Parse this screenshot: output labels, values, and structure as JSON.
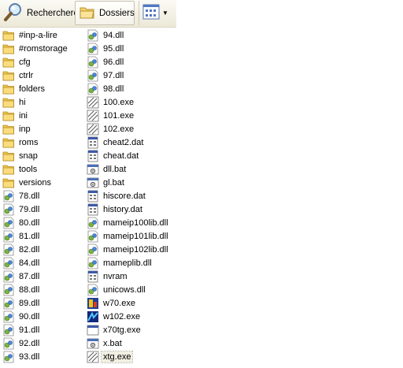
{
  "toolbar": {
    "search_label": "Recherchercher",
    "folders_label": "Dossiers"
  },
  "files_col1": [
    {
      "name": "#inp-a-lire",
      "type": "folder"
    },
    {
      "name": "#romstorage",
      "type": "folder"
    },
    {
      "name": "cfg",
      "type": "folder"
    },
    {
      "name": "ctrlr",
      "type": "folder"
    },
    {
      "name": "folders",
      "type": "folder"
    },
    {
      "name": "hi",
      "type": "folder"
    },
    {
      "name": "ini",
      "type": "folder"
    },
    {
      "name": "inp",
      "type": "folder"
    },
    {
      "name": "roms",
      "type": "folder"
    },
    {
      "name": "snap",
      "type": "folder"
    },
    {
      "name": "tools",
      "type": "folder"
    },
    {
      "name": "versions",
      "type": "folder"
    },
    {
      "name": "78.dll",
      "type": "dll"
    },
    {
      "name": "79.dll",
      "type": "dll"
    },
    {
      "name": "80.dll",
      "type": "dll"
    },
    {
      "name": "81.dll",
      "type": "dll"
    },
    {
      "name": "82.dll",
      "type": "dll"
    },
    {
      "name": "84.dll",
      "type": "dll"
    },
    {
      "name": "87.dll",
      "type": "dll"
    },
    {
      "name": "88.dll",
      "type": "dll"
    },
    {
      "name": "89.dll",
      "type": "dll"
    },
    {
      "name": "90.dll",
      "type": "dll"
    },
    {
      "name": "91.dll",
      "type": "dll"
    },
    {
      "name": "92.dll",
      "type": "dll"
    },
    {
      "name": "93.dll",
      "type": "dll"
    }
  ],
  "files_col2": [
    {
      "name": "94.dll",
      "type": "dll"
    },
    {
      "name": "95.dll",
      "type": "dll"
    },
    {
      "name": "96.dll",
      "type": "dll"
    },
    {
      "name": "97.dll",
      "type": "dll"
    },
    {
      "name": "98.dll",
      "type": "dll"
    },
    {
      "name": "100.exe",
      "type": "exe"
    },
    {
      "name": "101.exe",
      "type": "exe"
    },
    {
      "name": "102.exe",
      "type": "exe"
    },
    {
      "name": "cheat2.dat",
      "type": "dat"
    },
    {
      "name": "cheat.dat",
      "type": "dat"
    },
    {
      "name": "dll.bat",
      "type": "bat"
    },
    {
      "name": "gl.bat",
      "type": "bat"
    },
    {
      "name": "hiscore.dat",
      "type": "dat"
    },
    {
      "name": "history.dat",
      "type": "dat"
    },
    {
      "name": "mameip100lib.dll",
      "type": "dll"
    },
    {
      "name": "mameip101lib.dll",
      "type": "dll"
    },
    {
      "name": "mameip102lib.dll",
      "type": "dll"
    },
    {
      "name": "mameplib.dll",
      "type": "dll"
    },
    {
      "name": "nvram",
      "type": "dat"
    },
    {
      "name": "unicows.dll",
      "type": "dll"
    },
    {
      "name": "w70.exe",
      "type": "exe-app"
    },
    {
      "name": "w102.exe",
      "type": "exe-app2"
    },
    {
      "name": "x70tg.exe",
      "type": "exe-window"
    },
    {
      "name": "x.bat",
      "type": "bat"
    },
    {
      "name": "xtg.exe",
      "type": "exe",
      "selected": true
    }
  ]
}
